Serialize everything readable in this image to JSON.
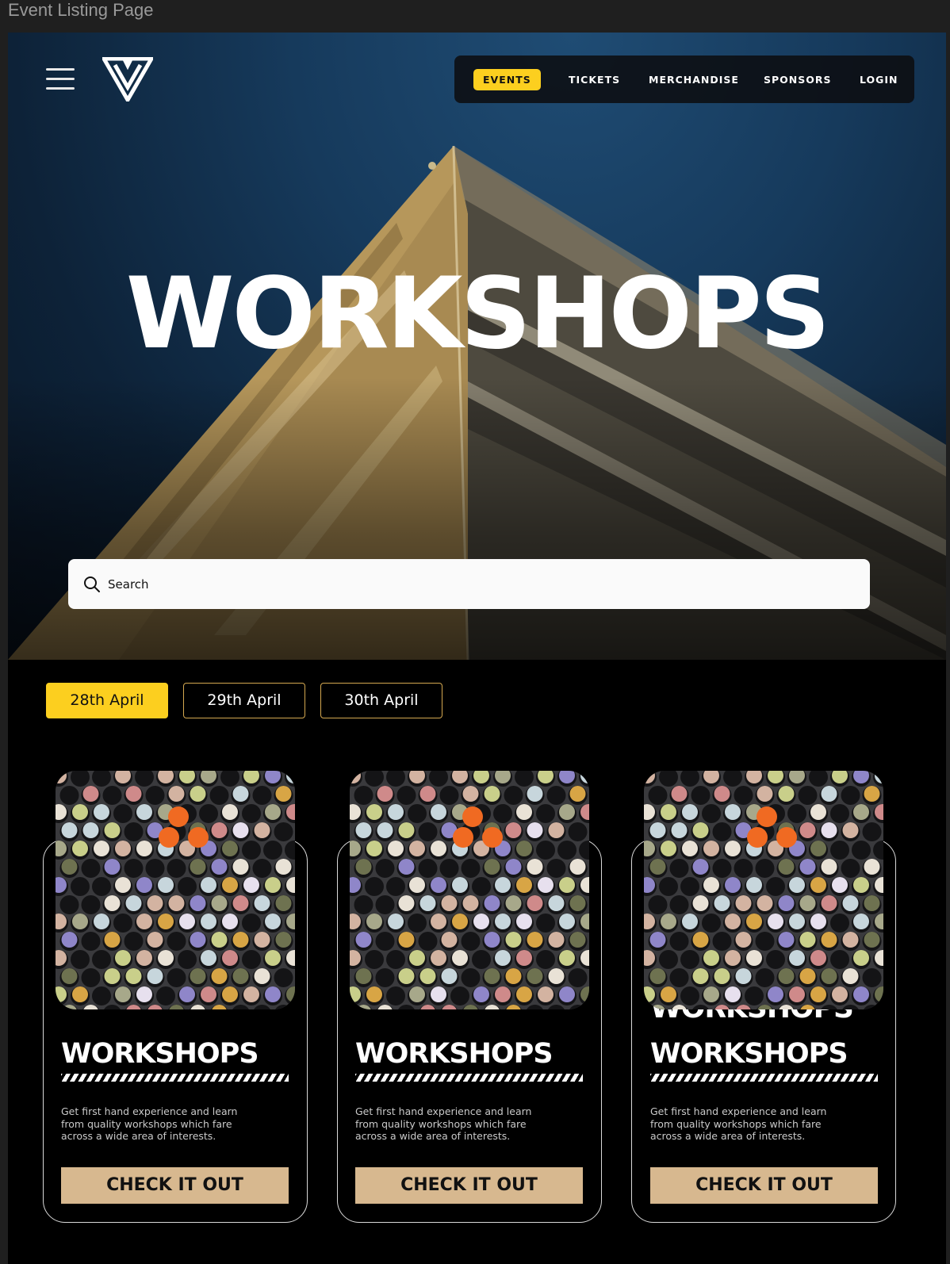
{
  "frame_label": "Event Listing Page",
  "nav": {
    "items": [
      {
        "label": "EVENTS",
        "active": true
      },
      {
        "label": "TICKETS",
        "active": false
      },
      {
        "label": "MERCHANDISE",
        "active": false
      },
      {
        "label": "SPONSORS",
        "active": false
      },
      {
        "label": "LOGIN",
        "active": false
      }
    ]
  },
  "hero": {
    "title": "WORKSHOPS"
  },
  "search": {
    "placeholder": "Search",
    "value": ""
  },
  "dates": [
    {
      "label": "28th April",
      "active": true
    },
    {
      "label": "29th April",
      "active": false
    },
    {
      "label": "30th April",
      "active": false
    }
  ],
  "cards": [
    {
      "title": "WORKSHOPS",
      "description": "Get first hand experience and learn from quality workshops which fare across a wide area of interests.",
      "button": "CHECK IT OUT"
    },
    {
      "title": "WORKSHOPS",
      "description": "Get first hand experience and learn from quality workshops which fare across a wide area of interests.",
      "button": "CHECK IT OUT"
    },
    {
      "title": "WORKSHOPS",
      "ghost_title": "WORKSHOPS",
      "description": "Get first hand experience and learn from quality workshops which fare across a wide area of interests.",
      "button": "CHECK IT OUT"
    }
  ],
  "colors": {
    "accent_yellow": "#fccf1f",
    "button_tan": "#d7b88f",
    "date_border": "#d4a850",
    "background": "#000000"
  },
  "icons": [
    "menu-icon",
    "logo-icon",
    "search-icon"
  ]
}
